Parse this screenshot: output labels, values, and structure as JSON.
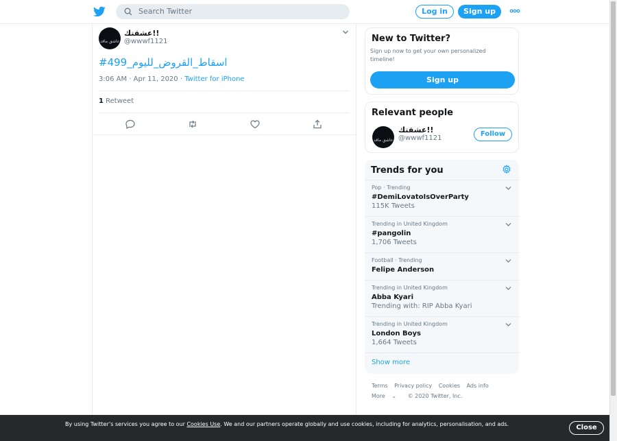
{
  "header": {
    "search_placeholder": "Search Twitter",
    "login_label": "Log in",
    "signup_label": "Sign up"
  },
  "tweet": {
    "author_name": "!!عشقتك",
    "author_handle": "@wwwf1121",
    "avatar_text": "عاشق ماقد",
    "text": "#اسقاط_القروض_لليوم_499",
    "timestamp": "3:06 AM · Apr 11, 2020",
    "dot_sep": " · ",
    "source": "Twitter for iPhone",
    "retweet_count": "1",
    "retweet_label": "Retweet"
  },
  "new_to_twitter": {
    "title": "New to Twitter?",
    "description": "Sign up now to get your own personalized timeline!",
    "button_label": "Sign up"
  },
  "relevant_people": {
    "title": "Relevant people",
    "name": "!!عشقتك",
    "handle": "@wwwf1121",
    "avatar_text": "عاشق ماقد",
    "follow_label": "Follow"
  },
  "trends": {
    "title": "Trends for you",
    "items": [
      {
        "category": "Pop · Trending",
        "name": "#DemiLovatoIsOverParty",
        "count": "115K Tweets"
      },
      {
        "category": "Trending in United Kingdom",
        "name": "#pangolin",
        "count": "1,706 Tweets"
      },
      {
        "category": "Football · Trending",
        "name": "Felipe Anderson",
        "count": ""
      },
      {
        "category": "Trending in United Kingdom",
        "name": "Abba Kyari",
        "count": "Trending with: RIP Abba Kyari"
      },
      {
        "category": "Trending in United Kingdom",
        "name": "London Boys",
        "count": "1,664 Tweets"
      }
    ],
    "show_more": "Show more"
  },
  "footer": {
    "links": [
      "Terms",
      "Privacy policy",
      "Cookies",
      "Ads info"
    ],
    "more": "More",
    "copyright": "© 2020 Twitter, Inc."
  },
  "cookie_bar": {
    "text_before": "By using Twitter’s services you agree to our ",
    "link": "Cookies Use",
    "text_after": ". We and our partners operate globally and use cookies, including for analytics, personalisation, and ads.",
    "close_label": "Close"
  },
  "colors": {
    "accent": "#1da1f2",
    "text": "#14171a",
    "secondary": "#657786",
    "border": "#e6ecf0",
    "trends_bg": "#f5f8fa"
  }
}
